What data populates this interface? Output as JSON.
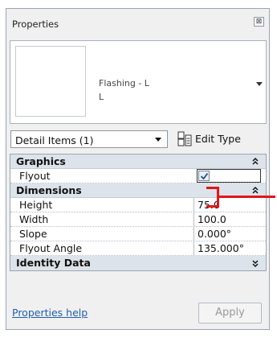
{
  "panel": {
    "title": "Properties",
    "close_glyph": "⊠"
  },
  "type_selector": {
    "family_name": "Flashing - L",
    "type_name": "L"
  },
  "instance_selector": {
    "label": "Detail Items (1)"
  },
  "edit_type": {
    "label": "Edit Type"
  },
  "grid": {
    "graphics": {
      "header": "Graphics",
      "flyout_label": "Flyout",
      "flyout_checked": true
    },
    "dimensions": {
      "header": "Dimensions",
      "rows": [
        {
          "label": "Height",
          "value": "75.0"
        },
        {
          "label": "Width",
          "value": "100.0"
        },
        {
          "label": "Slope",
          "value": "0.000°"
        },
        {
          "label": "Flyout Angle",
          "value": "135.000°"
        }
      ]
    },
    "identity": {
      "header": "Identity Data"
    }
  },
  "footer": {
    "help_link": "Properties help",
    "apply_label": "Apply"
  },
  "colors": {
    "annotation_red": "#e0161b",
    "link_blue": "#1f5fb0",
    "header_bg": "#dde3ea"
  }
}
